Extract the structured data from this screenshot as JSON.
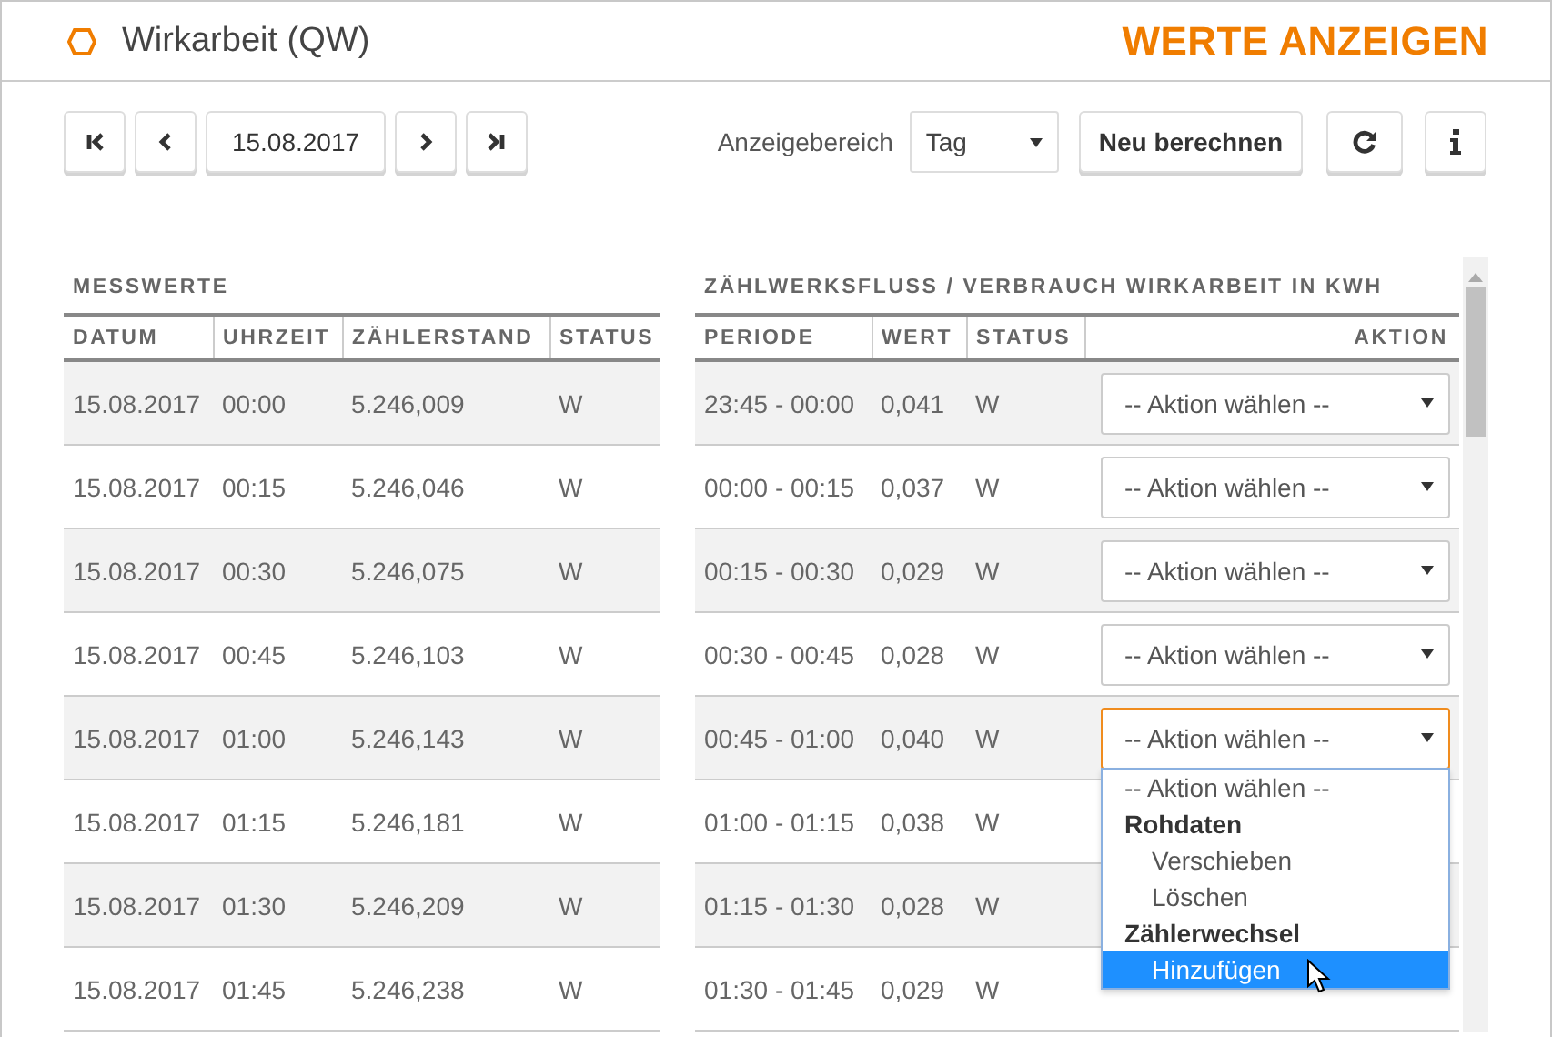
{
  "header": {
    "title": "Wirkarbeit (QW)",
    "action_title": "WERTE ANZEIGEN"
  },
  "toolbar": {
    "date": "15.08.2017",
    "range_label": "Anzeigebereich",
    "range_value": "Tag",
    "recalc_button": "Neu berechnen"
  },
  "measurements": {
    "title": "MESSWERTE",
    "columns": [
      "DATUM",
      "UHRZEIT",
      "ZÄHLERSTAND",
      "STATUS"
    ],
    "rows": [
      {
        "date": "15.08.2017",
        "time": "00:00",
        "reading": "5.246,009",
        "status": "W"
      },
      {
        "date": "15.08.2017",
        "time": "00:15",
        "reading": "5.246,046",
        "status": "W"
      },
      {
        "date": "15.08.2017",
        "time": "00:30",
        "reading": "5.246,075",
        "status": "W"
      },
      {
        "date": "15.08.2017",
        "time": "00:45",
        "reading": "5.246,103",
        "status": "W"
      },
      {
        "date": "15.08.2017",
        "time": "01:00",
        "reading": "5.246,143",
        "status": "W"
      },
      {
        "date": "15.08.2017",
        "time": "01:15",
        "reading": "5.246,181",
        "status": "W"
      },
      {
        "date": "15.08.2017",
        "time": "01:30",
        "reading": "5.246,209",
        "status": "W"
      },
      {
        "date": "15.08.2017",
        "time": "01:45",
        "reading": "5.246,238",
        "status": "W"
      }
    ]
  },
  "flow": {
    "title": "ZÄHLWERKSFLUSS / VERBRAUCH WIRKARBEIT IN KWH",
    "columns": [
      "PERIODE",
      "WERT",
      "STATUS",
      "AKTION"
    ],
    "rows": [
      {
        "period": "23:45 - 00:00",
        "value": "0,041",
        "status": "W",
        "action": "-- Aktion wählen --"
      },
      {
        "period": "00:00 - 00:15",
        "value": "0,037",
        "status": "W",
        "action": "-- Aktion wählen --"
      },
      {
        "period": "00:15 - 00:30",
        "value": "0,029",
        "status": "W",
        "action": "-- Aktion wählen --"
      },
      {
        "period": "00:30 - 00:45",
        "value": "0,028",
        "status": "W",
        "action": "-- Aktion wählen --"
      },
      {
        "period": "00:45 - 01:00",
        "value": "0,040",
        "status": "W",
        "action": "-- Aktion wählen --",
        "open": true,
        "options": [
          {
            "label": "-- Aktion wählen --",
            "kind": "option",
            "selected": false
          },
          {
            "label": "Rohdaten",
            "kind": "group",
            "selected": false
          },
          {
            "label": "Verschieben",
            "kind": "option",
            "selected": false
          },
          {
            "label": "Löschen",
            "kind": "option",
            "selected": false
          },
          {
            "label": "Zählerwechsel",
            "kind": "group",
            "selected": false
          },
          {
            "label": "Hinzufügen",
            "kind": "option",
            "selected": true
          }
        ]
      },
      {
        "period": "01:00 - 01:15",
        "value": "0,038",
        "status": "W"
      },
      {
        "period": "01:15 - 01:30",
        "value": "0,028",
        "status": "W"
      },
      {
        "period": "01:30 - 01:45",
        "value": "0,029",
        "status": "W"
      }
    ]
  }
}
